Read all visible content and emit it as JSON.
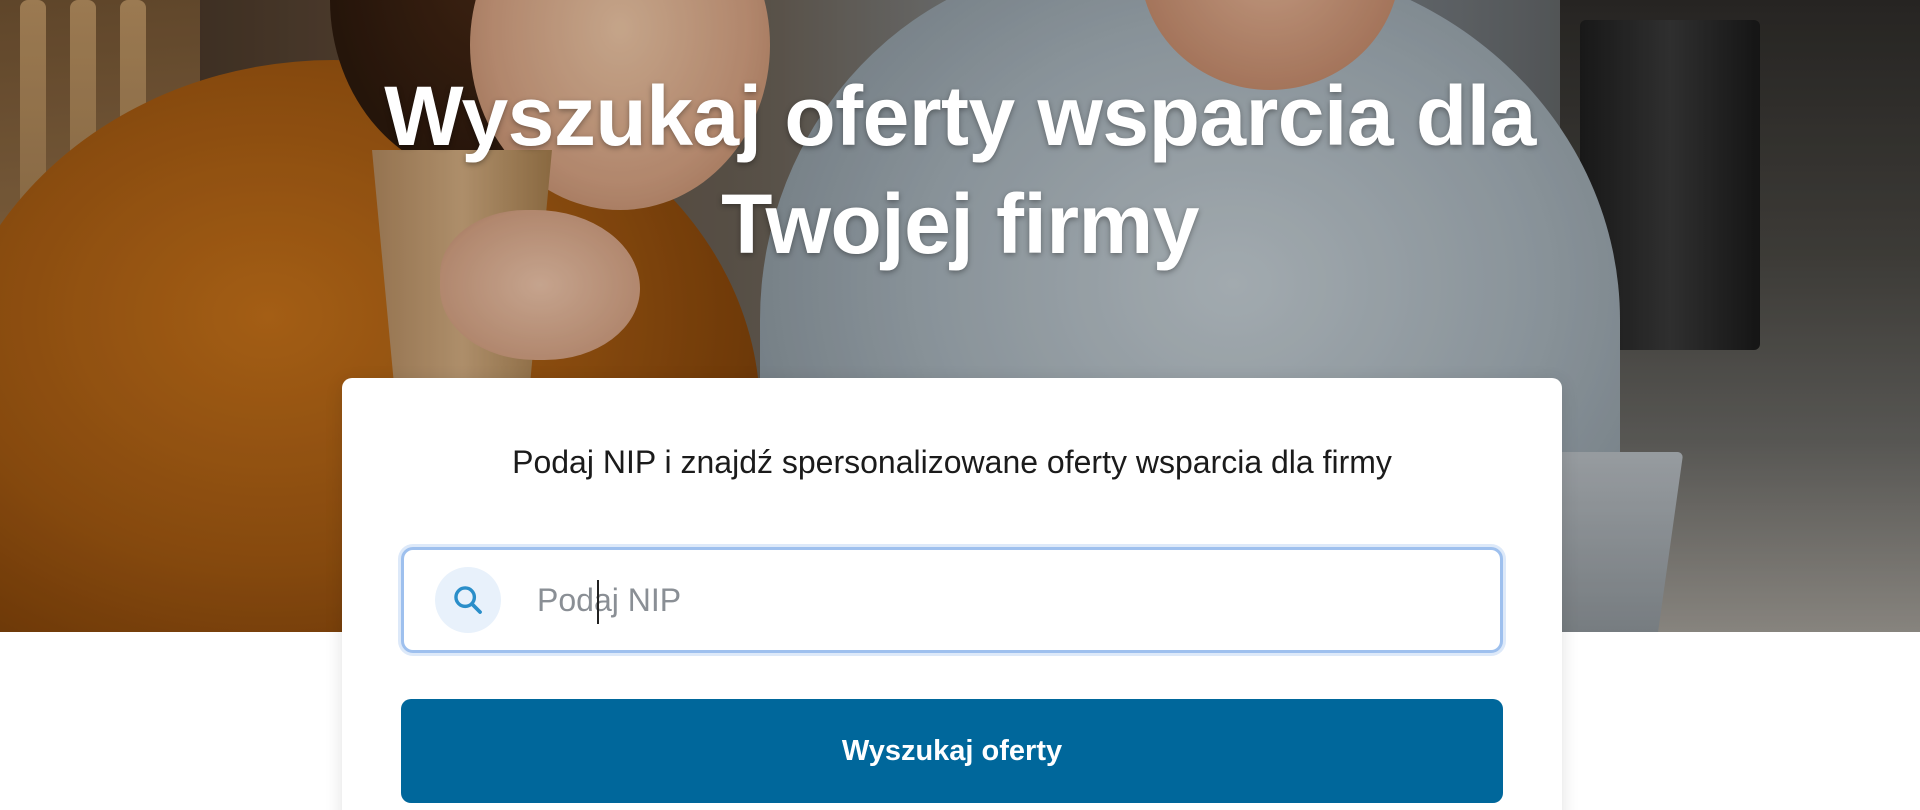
{
  "hero": {
    "title_line1": "Wyszukaj oferty wsparcia dla",
    "title_line2": "Twojej firmy"
  },
  "search_card": {
    "subtitle": "Podaj NIP i znajdź spersonalizowane oferty wsparcia dla firmy",
    "input": {
      "value": "",
      "placeholder": "Podaj NIP",
      "icon": "search-icon"
    },
    "submit_label": "Wyszukaj oferty"
  },
  "colors": {
    "button_bg": "#00679b",
    "input_focus_border": "#9ec0ee",
    "search_icon": "#2a8ec9",
    "search_icon_bg": "#e8f1fb",
    "title_text": "#ffffff"
  }
}
